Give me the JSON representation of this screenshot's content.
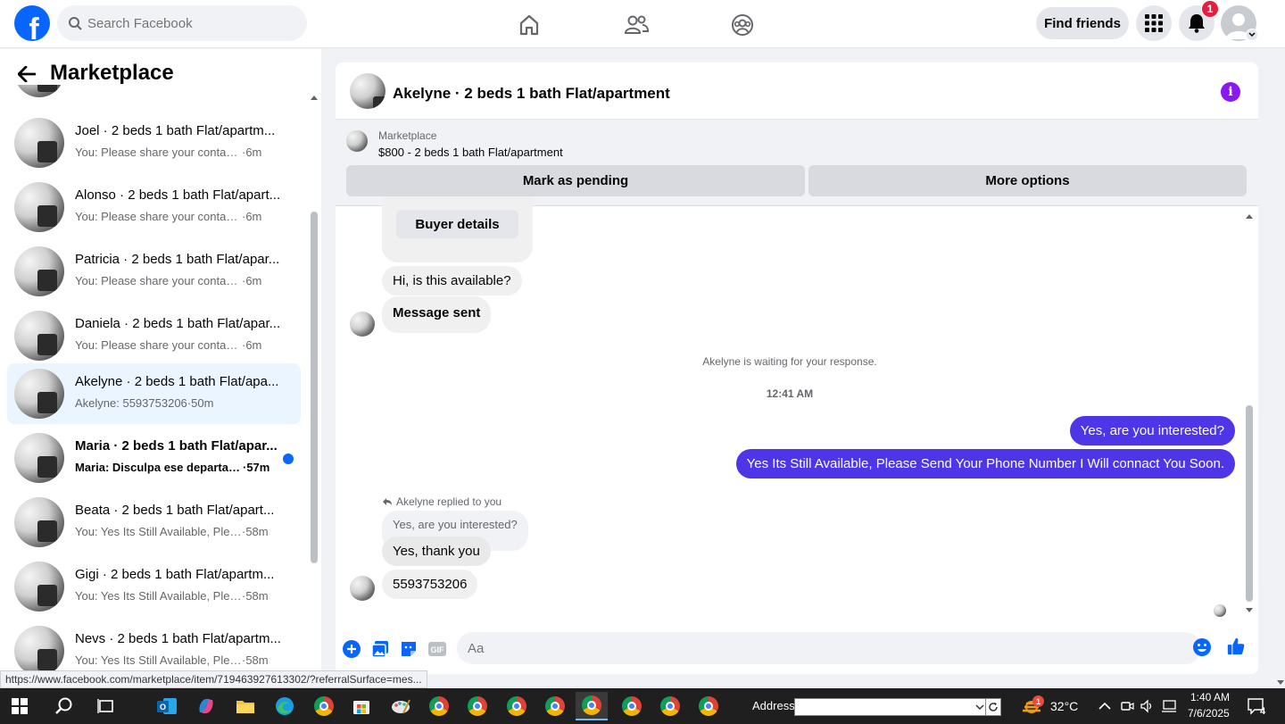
{
  "topbar": {
    "logo": "f",
    "search_placeholder": "Search Facebook",
    "find_friends": "Find friends",
    "notification_count": "1"
  },
  "sidebar": {
    "title": "Marketplace",
    "conversations": [
      {
        "title": "Joel · 2 beds 1 bath Flat/apartm...",
        "preview": "You: Please share your contact nu...",
        "time": " ·6m",
        "active": false,
        "unread": false
      },
      {
        "title": "Alonso · 2 beds 1 bath Flat/apart...",
        "preview": "You: Please share your contact nu...",
        "time": " ·6m",
        "active": false,
        "unread": false
      },
      {
        "title": "Patricia · 2 beds 1 bath Flat/apar...",
        "preview": "You: Please share your contact nu...",
        "time": " ·6m",
        "active": false,
        "unread": false
      },
      {
        "title": "Daniela · 2 beds 1 bath Flat/apar...",
        "preview": "You: Please share your contact nu...",
        "time": " ·6m",
        "active": false,
        "unread": false
      },
      {
        "title": "Akelyne · 2 beds 1 bath Flat/apa...",
        "preview": "Akelyne: 5593753206",
        "time": " ·50m",
        "active": true,
        "unread": false
      },
      {
        "title": "Maria · 2 beds 1 bath Flat/apar...",
        "preview": "Maria: Disculpa ese departam...",
        "time": " ·57m",
        "active": false,
        "unread": true
      },
      {
        "title": "Beata · 2 beds 1 bath Flat/apart...",
        "preview": "You: Yes Its Still Available, Please ...",
        "time": " ·58m",
        "active": false,
        "unread": false
      },
      {
        "title": "Gigi · 2 beds 1 bath Flat/apartm...",
        "preview": "You: Yes Its Still Available, Please ...",
        "time": " ·58m",
        "active": false,
        "unread": false
      },
      {
        "title": "Nevs · 2 beds 1 bath Flat/apartm...",
        "preview": "You: Yes Its Still Available, Please ...",
        "time": " ·58m",
        "active": false,
        "unread": false
      }
    ]
  },
  "chat": {
    "title": "Akelyne · 2 beds 1 bath Flat/apartment",
    "market_label": "Marketplace",
    "market_price": "$800 - 2 beds 1 bath Flat/apartment",
    "mark_pending": "Mark as pending",
    "more_options": "More options",
    "buyer_details": "Buyer details",
    "msg_available": "Hi, is this available?",
    "msg_sent": "Message sent",
    "waiting": "Akelyne is waiting for your response.",
    "timestamp": "12:41 AM",
    "out_1": "Yes, are you interested?",
    "out_2": "Yes Its Still Available, Please Send Your Phone Number I Will connact You Soon.",
    "reply_label": "Akelyne replied to you",
    "quoted": "Yes, are you interested?",
    "msg_thanks": "Yes, thank you",
    "msg_phone": "5593753206",
    "composer_placeholder": "Aa"
  },
  "status_url": "https://www.facebook.com/marketplace/item/719463927613302/?referralSurface=mes...",
  "taskbar": {
    "address_label": "Address",
    "temperature": "32°C",
    "weather_badge": "1",
    "time": "1:40 AM",
    "date": "7/6/2025",
    "notif_count": "4"
  },
  "colors": {
    "facebook_blue": "#0866ff",
    "outgoing_bubble": "#4f35e8",
    "info_purple": "#8b18f0",
    "notification_red": "#e41e3f"
  }
}
